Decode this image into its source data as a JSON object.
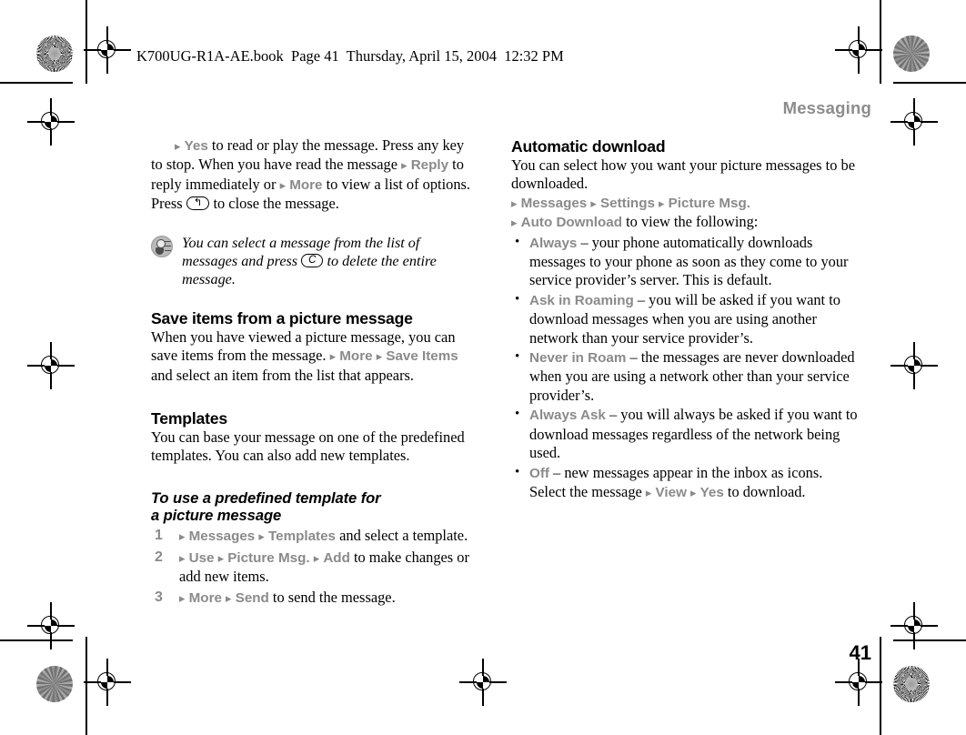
{
  "page": {
    "filestamp": "K700UG-R1A-AE.book  Page 41  Thursday, April 15, 2004  12:32 PM",
    "running_head": "Messaging",
    "folio": "41"
  },
  "left_column": {
    "intro": {
      "arrow1": "▸",
      "menu_yes": "Yes",
      "text1": " to read or play the message. Press any key to stop. When you have read the message ",
      "arrow2": "▸",
      "menu_reply": "Reply",
      "text2": " to reply immediately or ",
      "arrow3": "▸",
      "menu_more": "More",
      "text3": " to view a list of options. Press ",
      "key_back": "↰",
      "text4": " to close the message."
    },
    "tip": {
      "icon": "lightbulb-tip-icon",
      "text1": "You can select a message from the list of messages and press ",
      "key_clear": "C",
      "text2": " to delete the entire message."
    },
    "section_save": {
      "heading": "Save items from a picture message",
      "text1": "When you have viewed a picture message, you can save items from the message. ",
      "arrow1": "▸",
      "menu_more": "More",
      "arrow2": "▸",
      "menu_save_items": "Save Items",
      "text2": " and select an item from the list that appears."
    },
    "section_templates": {
      "heading": "Templates",
      "body": "You can base your message on one of the predefined templates. You can also add new templates."
    },
    "procedure": {
      "heading_line1": "To use a predefined template for",
      "heading_line2": "a picture message",
      "steps": [
        {
          "num": "1",
          "arrow1": "▸",
          "menu1": "Messages",
          "arrow2": "▸",
          "menu2": "Templates",
          "text": " and select a template."
        },
        {
          "num": "2",
          "arrow1": "▸",
          "menu1": "Use",
          "arrow2": "▸",
          "menu2": "Picture Msg.",
          "arrow3": "▸",
          "menu3": "Add",
          "text": " to make changes or add new items."
        },
        {
          "num": "3",
          "arrow1": "▸",
          "menu1": "More",
          "arrow2": "▸",
          "menu2": "Send",
          "text": " to send the message."
        }
      ]
    }
  },
  "right_column": {
    "heading": "Automatic download",
    "body": "You can select how you want your picture messages to be downloaded.",
    "path": {
      "arrow1": "▸",
      "menu1": "Messages",
      "arrow2": "▸",
      "menu2": "Settings",
      "arrow3": "▸",
      "menu3": "Picture Msg.",
      "arrow4": "▸",
      "menu4": "Auto Download",
      "text": " to view the following:"
    },
    "options": [
      {
        "bullet": "•",
        "label": "Always",
        "dash": " – ",
        "text": "your phone automatically downloads messages to your phone as soon as they come to your service provider’s server. This is default."
      },
      {
        "bullet": "•",
        "label": "Ask in Roaming",
        "dash": " – ",
        "text": "you will be asked if you want to download messages when you are using another network than your service provider’s."
      },
      {
        "bullet": "•",
        "label": "Never in Roam",
        "dash": " – ",
        "text": "the messages are never downloaded when you are using a network other than your service provider’s."
      },
      {
        "bullet": "•",
        "label": "Always Ask",
        "dash": " – ",
        "text": "you will always be asked if you want to download messages regardless of the network being used."
      },
      {
        "bullet": "•",
        "label": "Off",
        "dash": " – ",
        "text": "new messages appear in the inbox as icons. Select the message "
      }
    ],
    "off_tail": {
      "arrow1": "▸",
      "menu1": "View",
      "arrow2": "▸",
      "menu2": "Yes",
      "text": " to download."
    }
  },
  "colors": {
    "menu_gray": "#8a8a8a",
    "runhead_gray": "#8c8c8c",
    "text_black": "#000000",
    "page_white": "#ffffff"
  }
}
